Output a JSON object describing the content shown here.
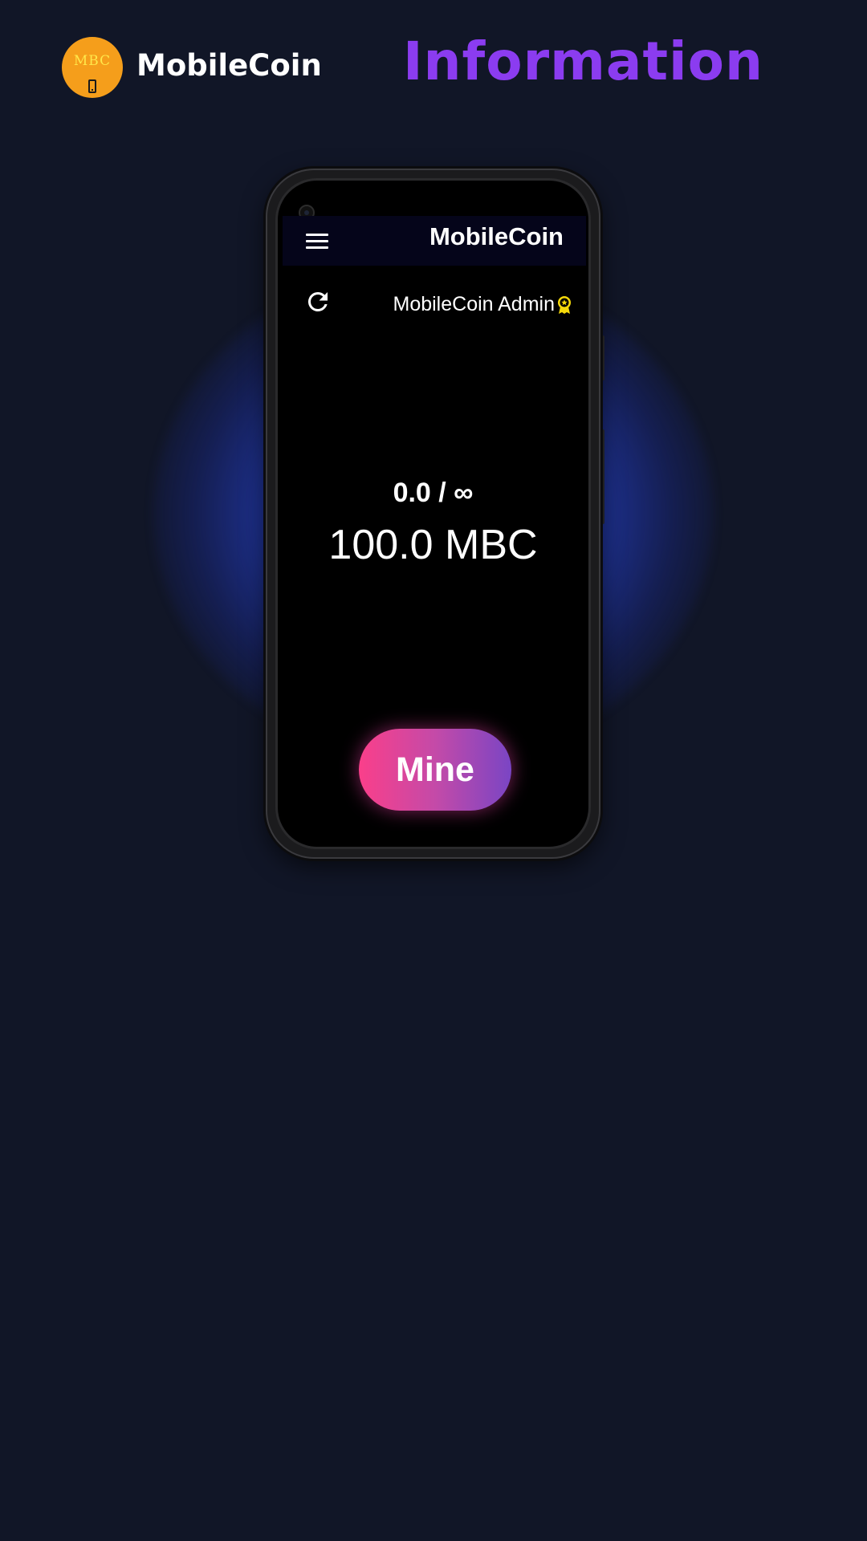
{
  "header": {
    "logo_text": "MBC",
    "brand_name": "MobileCoin",
    "page_title": "Information"
  },
  "phone": {
    "app_bar": {
      "title": "MobileCoin",
      "menu_icon": "hamburger-menu-icon"
    },
    "refresh_icon": "refresh-icon",
    "admin_label": "MobileCoin Admin",
    "admin_badge_icon": "award-badge-icon",
    "counter": "0.0 / ∞",
    "balance": "100.0 MBC",
    "mine_button_label": "Mine"
  },
  "colors": {
    "background": "#111627",
    "title_accent": "#8b3cf0",
    "logo": "#f59e1b",
    "glow": "#345af0",
    "mine_gradient_start": "#fa3f8a",
    "mine_gradient_end": "#7a45c4",
    "badge": "#f5d90a"
  }
}
